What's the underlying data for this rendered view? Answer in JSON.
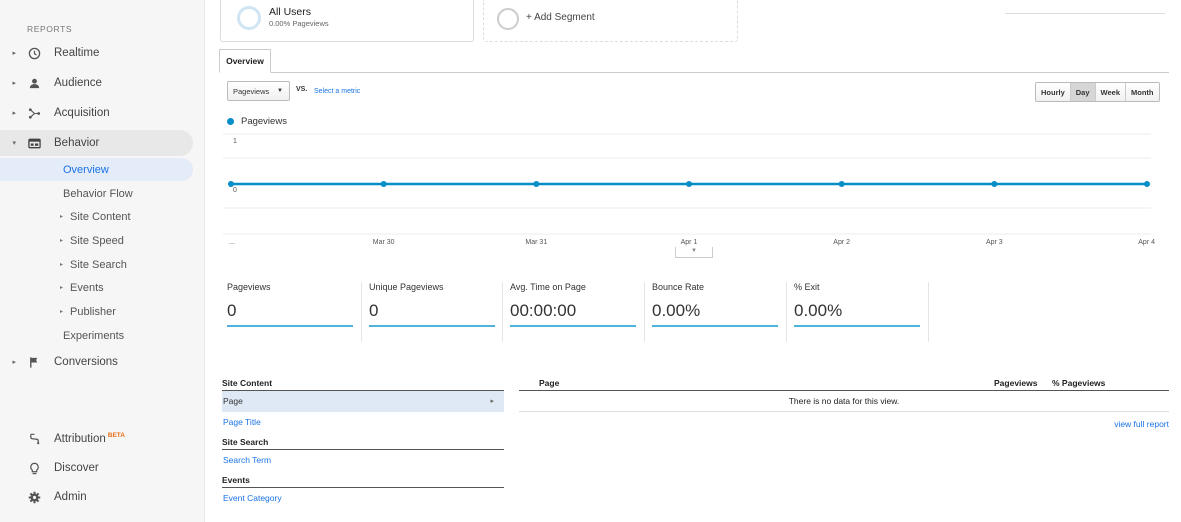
{
  "sidebar": {
    "section_label": "REPORTS",
    "items": [
      {
        "label": "Realtime",
        "icon": "clock-icon"
      },
      {
        "label": "Audience",
        "icon": "person-icon"
      },
      {
        "label": "Acquisition",
        "icon": "acquisition-icon"
      },
      {
        "label": "Behavior",
        "icon": "behavior-icon"
      }
    ],
    "behavior_sub": [
      {
        "label": "Overview"
      },
      {
        "label": "Behavior Flow"
      },
      {
        "label": "Site Content"
      },
      {
        "label": "Site Speed"
      },
      {
        "label": "Site Search"
      },
      {
        "label": "Events"
      },
      {
        "label": "Publisher"
      },
      {
        "label": "Experiments"
      }
    ],
    "conversions": "Conversions",
    "attribution": "Attribution",
    "attribution_badge": "BETA",
    "discover": "Discover",
    "admin": "Admin"
  },
  "segments": {
    "all_users_title": "All Users",
    "all_users_sub": "0.00% Pageviews",
    "add_segment": "+ Add Segment"
  },
  "tab": {
    "overview": "Overview"
  },
  "chart_controls": {
    "metric": "Pageviews",
    "vs": "VS.",
    "select_metric": "Select a metric",
    "periods": [
      "Hourly",
      "Day",
      "Week",
      "Month"
    ],
    "active_period": "Day"
  },
  "legend": {
    "series": "Pageviews"
  },
  "chart_data": {
    "type": "line",
    "x": [
      "...",
      "Mar 30",
      "Mar 31",
      "Apr 1",
      "Apr 2",
      "Apr 3",
      "Apr 4"
    ],
    "series": [
      {
        "name": "Pageviews",
        "values": [
          0,
          0,
          0,
          0,
          0,
          0,
          0
        ]
      }
    ],
    "y_ticks": [
      "1",
      "0"
    ],
    "ylim": [
      0,
      1
    ],
    "grid": true,
    "color": "#058dc7"
  },
  "scorecards": [
    {
      "label": "Pageviews",
      "value": "0"
    },
    {
      "label": "Unique Pageviews",
      "value": "0"
    },
    {
      "label": "Avg. Time on Page",
      "value": "00:00:00"
    },
    {
      "label": "Bounce Rate",
      "value": "0.00%"
    },
    {
      "label": "% Exit",
      "value": "0.00%"
    }
  ],
  "left_table": {
    "site_content": "Site Content",
    "page": "Page",
    "page_title": "Page Title",
    "site_search": "Site Search",
    "search_term": "Search Term",
    "events": "Events",
    "event_category": "Event Category"
  },
  "right_table": {
    "col_page": "Page",
    "col_pageviews": "Pageviews",
    "col_pct": "% Pageviews",
    "empty": "There is no data for this view.",
    "view_full": "view full report"
  }
}
